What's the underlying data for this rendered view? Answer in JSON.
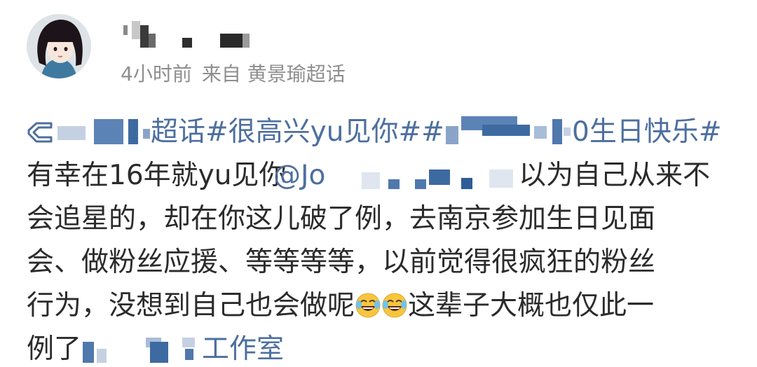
{
  "post": {
    "author_avatar_icon": "avatar-girl-dark-hair",
    "time": "4小时前",
    "source": "来自 黄景瑜超话",
    "topic_line": {
      "icon": "supertopic-icon",
      "text_a": "超话#很高兴yu见你##",
      "text_b": "0生日快乐#"
    },
    "line2": {
      "text_a": "有幸在16年就yu见你",
      "mention": "@Jo",
      "text_b": "以为自己从来不"
    },
    "line3": "会追星的，却在你这儿破了例，去南京参加生日见面",
    "line4": "会、做粉丝应援、等等等等，以前觉得很疯狂的粉丝",
    "line5": {
      "text_a": "行为，没想到自己也会做呢",
      "emoji": "laugh-cry-icon",
      "text_b": "这辈子大概也仅此一"
    },
    "line6": {
      "text_a": "例了",
      "link": "工作室"
    }
  },
  "colors": {
    "link": "#4d6f9f",
    "meta": "#8e8e8e",
    "text": "#2b2b2b",
    "background": "#ffffff"
  }
}
